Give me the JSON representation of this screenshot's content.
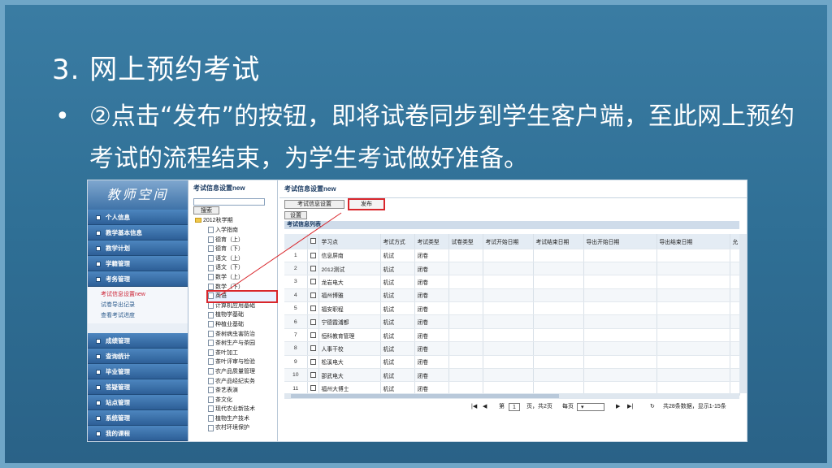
{
  "slide": {
    "title": "3. 网上预约考试",
    "bullet": "•",
    "text": "②点击“发布”的按钮，即将试卷同步到学生客户端，至此网上预约考试的流程结束，为学生考试做好准备。"
  },
  "app": {
    "logo": "教师空间",
    "nav": [
      "个人信息",
      "教学基本信息",
      "教学计划",
      "学籍管理",
      "考务管理"
    ],
    "nav_sub": [
      "考试信息设置new",
      "试卷导出记录",
      "查看考试进度"
    ],
    "nav_bottom": [
      "成绩管理",
      "查询统计",
      "毕业管理",
      "答疑管理",
      "站点管理",
      "系统管理",
      "我的课程"
    ]
  },
  "tree": {
    "header": "考试信息设置new",
    "search_label": "搜索",
    "root": "2012秋学期",
    "nodes": [
      "入学指南",
      "德育（上）",
      "德育（下）",
      "语文（上）",
      "语文（下）",
      "数学（上）",
      "数学（下）",
      "英语",
      "计算机应用基础",
      "植物学基础",
      "种植业基础",
      "茶树病虫害防治",
      "茶树生产与茶园",
      "茶叶加工",
      "茶叶评审与检验",
      "农产品质量管理",
      "农产品经纪实务",
      "茶艺表演",
      "茶文化",
      "现代农业新技术",
      "植物生产技术",
      "农村环境保护"
    ]
  },
  "main": {
    "top_title": "考试信息设置new",
    "btn_settings": "考试信息设置",
    "btn_publish": "发布",
    "btn_set": "设置",
    "grid_title": "考试信息列表",
    "columns": [
      "学习点",
      "考试方式",
      "考试类型",
      "试卷类型",
      "考试开始日期",
      "考试结束日期",
      "导出开始日期",
      "导出结束日期",
      "允"
    ],
    "rows": [
      {
        "n": "1",
        "site": "信息屏南",
        "mode": "机试",
        "type": "闭卷"
      },
      {
        "n": "2",
        "site": "2012测试",
        "mode": "机试",
        "type": "闭卷"
      },
      {
        "n": "3",
        "site": "龙岩电大",
        "mode": "机试",
        "type": "闭卷"
      },
      {
        "n": "4",
        "site": "福州博雅",
        "mode": "机试",
        "type": "闭卷"
      },
      {
        "n": "5",
        "site": "福安职程",
        "mode": "机试",
        "type": "闭卷"
      },
      {
        "n": "6",
        "site": "宁德霞浦都",
        "mode": "机试",
        "type": "闭卷"
      },
      {
        "n": "7",
        "site": "恒科教育管理",
        "mode": "机试",
        "type": "闭卷"
      },
      {
        "n": "8",
        "site": "人事干校",
        "mode": "机试",
        "type": "闭卷"
      },
      {
        "n": "9",
        "site": "松溪电大",
        "mode": "机试",
        "type": "闭卷"
      },
      {
        "n": "10",
        "site": "邵武电大",
        "mode": "机试",
        "type": "闭卷"
      },
      {
        "n": "11",
        "site": "福州大博士",
        "mode": "机试",
        "type": "闭卷"
      }
    ],
    "pager": {
      "page_label": "第",
      "page_value": "1",
      "page_of": "页，共2页",
      "per_page": "每页",
      "summary": "共28条数据，显示1-15条"
    }
  }
}
